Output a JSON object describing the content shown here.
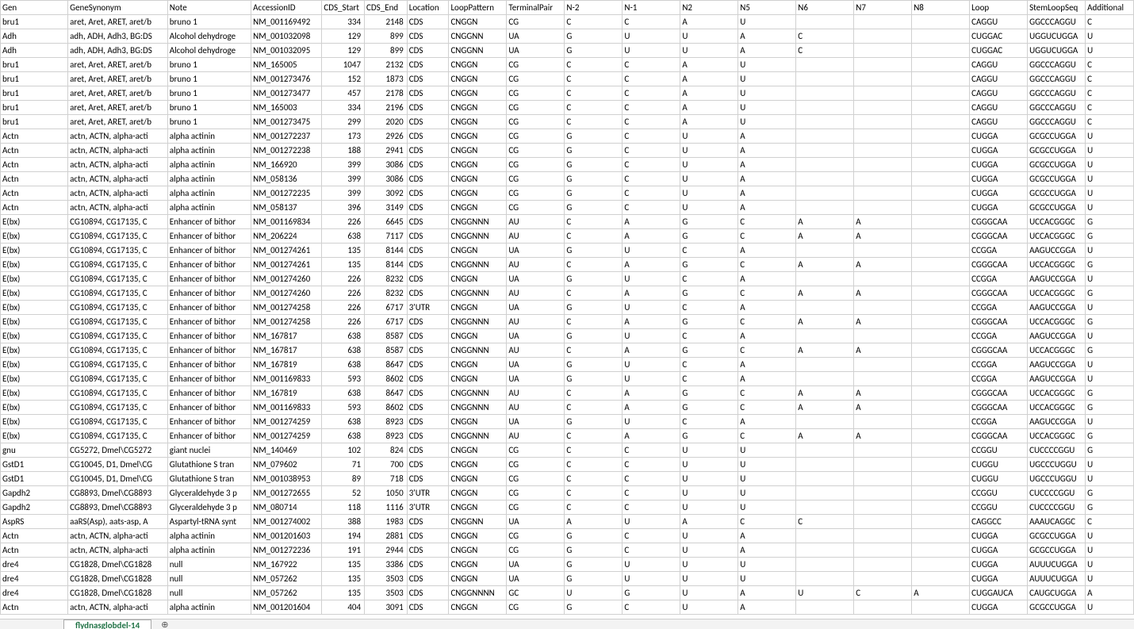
{
  "sheetTab": "flydnasglobdel-14",
  "headers": [
    "Gen",
    "GeneSynonym",
    "Note",
    "AccessionID",
    "CDS_Start",
    "CDS_End",
    "Location",
    "LoopPattern",
    "TerminalPair",
    "N-2",
    "N-1",
    "N2",
    "N5",
    "N6",
    "N7",
    "N8",
    "Loop",
    "StemLoopSeq",
    "Additional"
  ],
  "rows": [
    [
      "bru1",
      "aret, Aret, ARET, aret/b",
      "bruno 1",
      "NM_001169492",
      "334",
      "2148",
      "CDS",
      "CNGGN",
      "CG",
      "C",
      "C",
      "A",
      "U",
      "",
      "",
      "",
      "CAGGU",
      "GGCCCAGGU",
      "C"
    ],
    [
      "Adh",
      "adh, ADH, Adh3, BG:DS",
      "Alcohol dehydroge",
      "NM_001032098",
      "129",
      "899",
      "CDS",
      "CNGGNN",
      "UA",
      "G",
      "U",
      "U",
      "A",
      "C",
      "",
      "",
      "CUGGAC",
      "UGGUCUGGA",
      "U"
    ],
    [
      "Adh",
      "adh, ADH, Adh3, BG:DS",
      "Alcohol dehydroge",
      "NM_001032095",
      "129",
      "899",
      "CDS",
      "CNGGNN",
      "UA",
      "G",
      "U",
      "U",
      "A",
      "C",
      "",
      "",
      "CUGGAC",
      "UGGUCUGGA",
      "U"
    ],
    [
      "bru1",
      "aret, Aret, ARET, aret/b",
      "bruno 1",
      "NM_165005",
      "1047",
      "2132",
      "CDS",
      "CNGGN",
      "CG",
      "C",
      "C",
      "A",
      "U",
      "",
      "",
      "",
      "CAGGU",
      "GGCCCAGGU",
      "C"
    ],
    [
      "bru1",
      "aret, Aret, ARET, aret/b",
      "bruno 1",
      "NM_001273476",
      "152",
      "1873",
      "CDS",
      "CNGGN",
      "CG",
      "C",
      "C",
      "A",
      "U",
      "",
      "",
      "",
      "CAGGU",
      "GGCCCAGGU",
      "C"
    ],
    [
      "bru1",
      "aret, Aret, ARET, aret/b",
      "bruno 1",
      "NM_001273477",
      "457",
      "2178",
      "CDS",
      "CNGGN",
      "CG",
      "C",
      "C",
      "A",
      "U",
      "",
      "",
      "",
      "CAGGU",
      "GGCCCAGGU",
      "C"
    ],
    [
      "bru1",
      "aret, Aret, ARET, aret/b",
      "bruno 1",
      "NM_165003",
      "334",
      "2196",
      "CDS",
      "CNGGN",
      "CG",
      "C",
      "C",
      "A",
      "U",
      "",
      "",
      "",
      "CAGGU",
      "GGCCCAGGU",
      "C"
    ],
    [
      "bru1",
      "aret, Aret, ARET, aret/b",
      "bruno 1",
      "NM_001273475",
      "299",
      "2020",
      "CDS",
      "CNGGN",
      "CG",
      "C",
      "C",
      "A",
      "U",
      "",
      "",
      "",
      "CAGGU",
      "GGCCCAGGU",
      "C"
    ],
    [
      "Actn",
      "actn, ACTN, alpha-acti",
      "alpha actinin",
      "NM_001272237",
      "173",
      "2926",
      "CDS",
      "CNGGN",
      "CG",
      "G",
      "C",
      "U",
      "A",
      "",
      "",
      "",
      "CUGGA",
      "GCGCCUGGA",
      "U"
    ],
    [
      "Actn",
      "actn, ACTN, alpha-acti",
      "alpha actinin",
      "NM_001272238",
      "188",
      "2941",
      "CDS",
      "CNGGN",
      "CG",
      "G",
      "C",
      "U",
      "A",
      "",
      "",
      "",
      "CUGGA",
      "GCGCCUGGA",
      "U"
    ],
    [
      "Actn",
      "actn, ACTN, alpha-acti",
      "alpha actinin",
      "NM_166920",
      "399",
      "3086",
      "CDS",
      "CNGGN",
      "CG",
      "G",
      "C",
      "U",
      "A",
      "",
      "",
      "",
      "CUGGA",
      "GCGCCUGGA",
      "U"
    ],
    [
      "Actn",
      "actn, ACTN, alpha-acti",
      "alpha actinin",
      "NM_058136",
      "399",
      "3086",
      "CDS",
      "CNGGN",
      "CG",
      "G",
      "C",
      "U",
      "A",
      "",
      "",
      "",
      "CUGGA",
      "GCGCCUGGA",
      "U"
    ],
    [
      "Actn",
      "actn, ACTN, alpha-acti",
      "alpha actinin",
      "NM_001272235",
      "399",
      "3092",
      "CDS",
      "CNGGN",
      "CG",
      "G",
      "C",
      "U",
      "A",
      "",
      "",
      "",
      "CUGGA",
      "GCGCCUGGA",
      "U"
    ],
    [
      "Actn",
      "actn, ACTN, alpha-acti",
      "alpha actinin",
      "NM_058137",
      "396",
      "3149",
      "CDS",
      "CNGGN",
      "CG",
      "G",
      "C",
      "U",
      "A",
      "",
      "",
      "",
      "CUGGA",
      "GCGCCUGGA",
      "U"
    ],
    [
      "E(bx)",
      "CG10894, CG17135, C",
      "Enhancer of bithor",
      "NM_001169834",
      "226",
      "6645",
      "CDS",
      "CNGGNNN",
      "AU",
      "C",
      "A",
      "G",
      "C",
      "A",
      "A",
      "",
      "CGGGCAA",
      "UCCACGGGC",
      "G"
    ],
    [
      "E(bx)",
      "CG10894, CG17135, C",
      "Enhancer of bithor",
      "NM_206224",
      "638",
      "7117",
      "CDS",
      "CNGGNNN",
      "AU",
      "C",
      "A",
      "G",
      "C",
      "A",
      "A",
      "",
      "CGGGCAA",
      "UCCACGGGC",
      "G"
    ],
    [
      "E(bx)",
      "CG10894, CG17135, C",
      "Enhancer of bithor",
      "NM_001274261",
      "135",
      "8144",
      "CDS",
      "CNGGN",
      "UA",
      "G",
      "U",
      "C",
      "A",
      "",
      "",
      "",
      "CCGGA",
      "AAGUCCGGA",
      "U"
    ],
    [
      "E(bx)",
      "CG10894, CG17135, C",
      "Enhancer of bithor",
      "NM_001274261",
      "135",
      "8144",
      "CDS",
      "CNGGNNN",
      "AU",
      "C",
      "A",
      "G",
      "C",
      "A",
      "A",
      "",
      "CGGGCAA",
      "UCCACGGGC",
      "G"
    ],
    [
      "E(bx)",
      "CG10894, CG17135, C",
      "Enhancer of bithor",
      "NM_001274260",
      "226",
      "8232",
      "CDS",
      "CNGGN",
      "UA",
      "G",
      "U",
      "C",
      "A",
      "",
      "",
      "",
      "CCGGA",
      "AAGUCCGGA",
      "U"
    ],
    [
      "E(bx)",
      "CG10894, CG17135, C",
      "Enhancer of bithor",
      "NM_001274260",
      "226",
      "8232",
      "CDS",
      "CNGGNNN",
      "AU",
      "C",
      "A",
      "G",
      "C",
      "A",
      "A",
      "",
      "CGGGCAA",
      "UCCACGGGC",
      "G"
    ],
    [
      "E(bx)",
      "CG10894, CG17135, C",
      "Enhancer of bithor",
      "NM_001274258",
      "226",
      "6717",
      "3'UTR",
      "CNGGN",
      "UA",
      "G",
      "U",
      "C",
      "A",
      "",
      "",
      "",
      "CCGGA",
      "AAGUCCGGA",
      "U"
    ],
    [
      "E(bx)",
      "CG10894, CG17135, C",
      "Enhancer of bithor",
      "NM_001274258",
      "226",
      "6717",
      "CDS",
      "CNGGNNN",
      "AU",
      "C",
      "A",
      "G",
      "C",
      "A",
      "A",
      "",
      "CGGGCAA",
      "UCCACGGGC",
      "G"
    ],
    [
      "E(bx)",
      "CG10894, CG17135, C",
      "Enhancer of bithor",
      "NM_167817",
      "638",
      "8587",
      "CDS",
      "CNGGN",
      "UA",
      "G",
      "U",
      "C",
      "A",
      "",
      "",
      "",
      "CCGGA",
      "AAGUCCGGA",
      "U"
    ],
    [
      "E(bx)",
      "CG10894, CG17135, C",
      "Enhancer of bithor",
      "NM_167817",
      "638",
      "8587",
      "CDS",
      "CNGGNNN",
      "AU",
      "C",
      "A",
      "G",
      "C",
      "A",
      "A",
      "",
      "CGGGCAA",
      "UCCACGGGC",
      "G"
    ],
    [
      "E(bx)",
      "CG10894, CG17135, C",
      "Enhancer of bithor",
      "NM_167819",
      "638",
      "8647",
      "CDS",
      "CNGGN",
      "UA",
      "G",
      "U",
      "C",
      "A",
      "",
      "",
      "",
      "CCGGA",
      "AAGUCCGGA",
      "U"
    ],
    [
      "E(bx)",
      "CG10894, CG17135, C",
      "Enhancer of bithor",
      "NM_001169833",
      "593",
      "8602",
      "CDS",
      "CNGGN",
      "UA",
      "G",
      "U",
      "C",
      "A",
      "",
      "",
      "",
      "CCGGA",
      "AAGUCCGGA",
      "U"
    ],
    [
      "E(bx)",
      "CG10894, CG17135, C",
      "Enhancer of bithor",
      "NM_167819",
      "638",
      "8647",
      "CDS",
      "CNGGNNN",
      "AU",
      "C",
      "A",
      "G",
      "C",
      "A",
      "A",
      "",
      "CGGGCAA",
      "UCCACGGGC",
      "G"
    ],
    [
      "E(bx)",
      "CG10894, CG17135, C",
      "Enhancer of bithor",
      "NM_001169833",
      "593",
      "8602",
      "CDS",
      "CNGGNNN",
      "AU",
      "C",
      "A",
      "G",
      "C",
      "A",
      "A",
      "",
      "CGGGCAA",
      "UCCACGGGC",
      "G"
    ],
    [
      "E(bx)",
      "CG10894, CG17135, C",
      "Enhancer of bithor",
      "NM_001274259",
      "638",
      "8923",
      "CDS",
      "CNGGN",
      "UA",
      "G",
      "U",
      "C",
      "A",
      "",
      "",
      "",
      "CCGGA",
      "AAGUCCGGA",
      "U"
    ],
    [
      "E(bx)",
      "CG10894, CG17135, C",
      "Enhancer of bithor",
      "NM_001274259",
      "638",
      "8923",
      "CDS",
      "CNGGNNN",
      "AU",
      "C",
      "A",
      "G",
      "C",
      "A",
      "A",
      "",
      "CGGGCAA",
      "UCCACGGGC",
      "G"
    ],
    [
      "gnu",
      "CG5272, Dmel\\CG5272",
      "giant nuclei",
      "NM_140469",
      "102",
      "824",
      "CDS",
      "CNGGN",
      "CG",
      "C",
      "C",
      "U",
      "U",
      "",
      "",
      "",
      "CCGGU",
      "CUCCCCGGU",
      "G"
    ],
    [
      "GstD1",
      "CG10045, D1, Dmel\\CG",
      "Glutathione S tran",
      "NM_079602",
      "71",
      "700",
      "CDS",
      "CNGGN",
      "CG",
      "C",
      "C",
      "U",
      "U",
      "",
      "",
      "",
      "CUGGU",
      "UGCCCUGGU",
      "U"
    ],
    [
      "GstD1",
      "CG10045, D1, Dmel\\CG",
      "Glutathione S tran",
      "NM_001038953",
      "89",
      "718",
      "CDS",
      "CNGGN",
      "CG",
      "C",
      "C",
      "U",
      "U",
      "",
      "",
      "",
      "CUGGU",
      "UGCCCUGGU",
      "U"
    ],
    [
      "Gapdh2",
      "CG8893, Dmel\\CG8893",
      "Glyceraldehyde 3 p",
      "NM_001272655",
      "52",
      "1050",
      "3'UTR",
      "CNGGN",
      "CG",
      "C",
      "C",
      "U",
      "U",
      "",
      "",
      "",
      "CCGGU",
      "CUCCCCGGU",
      "G"
    ],
    [
      "Gapdh2",
      "CG8893, Dmel\\CG8893",
      "Glyceraldehyde 3 p",
      "NM_080714",
      "118",
      "1116",
      "3'UTR",
      "CNGGN",
      "CG",
      "C",
      "C",
      "U",
      "U",
      "",
      "",
      "",
      "CCGGU",
      "CUCCCCGGU",
      "G"
    ],
    [
      "AspRS",
      "aaRS(Asp), aats-asp, A",
      "Aspartyl-tRNA synt",
      "NM_001274002",
      "388",
      "1983",
      "CDS",
      "CNGGNN",
      "UA",
      "A",
      "U",
      "A",
      "C",
      "C",
      "",
      "",
      "CAGGCC",
      "AAAUCAGGC",
      "C"
    ],
    [
      "Actn",
      "actn, ACTN, alpha-acti",
      "alpha actinin",
      "NM_001201603",
      "194",
      "2881",
      "CDS",
      "CNGGN",
      "CG",
      "G",
      "C",
      "U",
      "A",
      "",
      "",
      "",
      "CUGGA",
      "GCGCCUGGA",
      "U"
    ],
    [
      "Actn",
      "actn, ACTN, alpha-acti",
      "alpha actinin",
      "NM_001272236",
      "191",
      "2944",
      "CDS",
      "CNGGN",
      "CG",
      "G",
      "C",
      "U",
      "A",
      "",
      "",
      "",
      "CUGGA",
      "GCGCCUGGA",
      "U"
    ],
    [
      "dre4",
      "CG1828, Dmel\\CG1828",
      "null",
      "NM_167922",
      "135",
      "3386",
      "CDS",
      "CNGGN",
      "UA",
      "G",
      "U",
      "U",
      "U",
      "",
      "",
      "",
      "CUGGA",
      "AUUUCUGGA",
      "U"
    ],
    [
      "dre4",
      "CG1828, Dmel\\CG1828",
      "null",
      "NM_057262",
      "135",
      "3503",
      "CDS",
      "CNGGN",
      "UA",
      "G",
      "U",
      "U",
      "U",
      "",
      "",
      "",
      "CUGGA",
      "AUUUCUGGA",
      "U"
    ],
    [
      "dre4",
      "CG1828, Dmel\\CG1828",
      "null",
      "NM_057262",
      "135",
      "3503",
      "CDS",
      "CNGGNNNN",
      "GC",
      "U",
      "G",
      "U",
      "A",
      "U",
      "C",
      "A",
      "CUGGAUCA",
      "CAUGCUGGA",
      "A"
    ],
    [
      "Actn",
      "actn, ACTN, alpha-acti",
      "alpha actinin",
      "NM_001201604",
      "404",
      "3091",
      "CDS",
      "CNGGN",
      "CG",
      "G",
      "C",
      "U",
      "A",
      "",
      "",
      "",
      "CUGGA",
      "GCGCCUGGA",
      "U"
    ]
  ]
}
